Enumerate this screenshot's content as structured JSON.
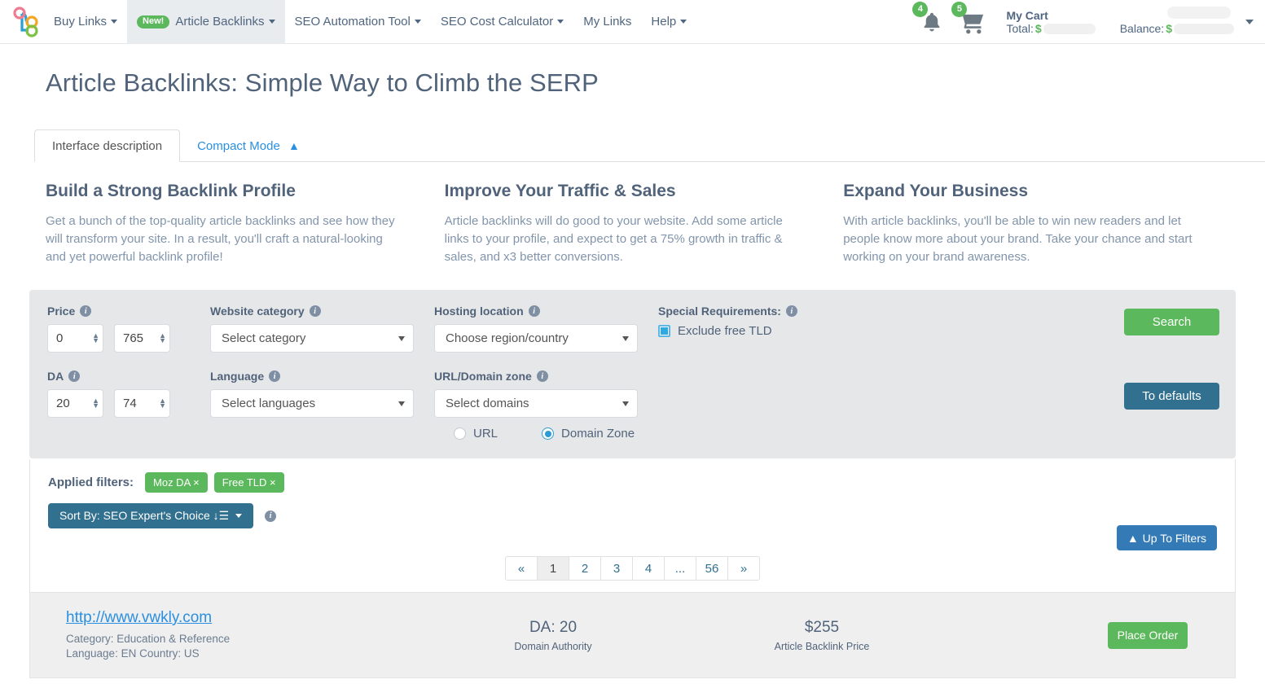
{
  "navbar": {
    "logo_icon": "node-tree-logo",
    "items": [
      {
        "label": "Buy Links",
        "has_caret": true,
        "badge": "",
        "active": false
      },
      {
        "label": "Article Backlinks",
        "has_caret": true,
        "badge": "New!",
        "active": true
      },
      {
        "label": "SEO Automation Tool",
        "has_caret": true,
        "badge": "",
        "active": false
      },
      {
        "label": "SEO Cost Calculator",
        "has_caret": true,
        "badge": "",
        "active": false
      },
      {
        "label": "My Links",
        "has_caret": false,
        "badge": "",
        "active": false
      },
      {
        "label": "Help",
        "has_caret": true,
        "badge": "",
        "active": false
      }
    ],
    "notifications_count": "4",
    "cart_count": "5",
    "cart_title": "My Cart",
    "cart_total_label": "Total:",
    "cart_currency": "$",
    "balance_label": "Balance:",
    "balance_currency": "$",
    "accent_green": "#5cb85c"
  },
  "page": {
    "title": "Article Backlinks: Simple Way to Climb the SERP"
  },
  "tabs": [
    {
      "label": "Interface description",
      "active": true
    },
    {
      "label": "Compact Mode",
      "active": false,
      "icon": "chevron-double-up-icon"
    }
  ],
  "features": [
    {
      "heading": "Build a Strong Backlink Profile",
      "text": "Get a bunch of the top-quality article backlinks and see how they will transform your site. In a result, you'll craft a natural-looking and yet powerful backlink profile!"
    },
    {
      "heading": "Improve Your Traffic & Sales",
      "text": "Article backlinks will do good to your website. Add some article links to your profile, and expect to get a 75% growth in traffic & sales, and x3 better conversions."
    },
    {
      "heading": "Expand Your Business",
      "text": "With article backlinks, you'll be able to win new readers and let people know more about your brand. Take your chance and start working on your brand awareness."
    }
  ],
  "filters": {
    "price": {
      "label": "Price",
      "min": "0",
      "max": "765"
    },
    "da": {
      "label": "DA",
      "min": "20",
      "max": "74"
    },
    "category": {
      "label": "Website category",
      "value": "Select category"
    },
    "language": {
      "label": "Language",
      "value": "Select languages"
    },
    "hosting": {
      "label": "Hosting location",
      "value": "Choose region/country"
    },
    "domain_zone": {
      "label": "URL/Domain zone",
      "value": "Select domains"
    },
    "special": {
      "label": "Special Requirements:",
      "checkbox_label": "Exclude free TLD",
      "checked": true
    },
    "radios": [
      {
        "label": "URL",
        "selected": false
      },
      {
        "label": "Domain Zone",
        "selected": true
      }
    ],
    "search_button": "Search",
    "defaults_button": "To defaults"
  },
  "applied": {
    "label": "Applied filters:",
    "tags": [
      "Moz DA ×",
      "Free TLD ×"
    ],
    "sort_button": "Sort By: SEO Expert's Choice ↓☰",
    "up_to_filters_button": "Up To Filters",
    "up_icon": "chevron-double-up-icon"
  },
  "pagination": {
    "items": [
      "«",
      "1",
      "2",
      "3",
      "4",
      "...",
      "56",
      "»"
    ],
    "active_index": 1
  },
  "results": [
    {
      "url": "http://www.vwkly.com",
      "category_line": "Category: Education & Reference",
      "language_line": "Language: EN Country: US",
      "da_value": "DA: 20",
      "da_label": "Domain Authority",
      "price_value": "$255",
      "price_label": "Article Backlink Price",
      "order_button": "Place Order"
    }
  ]
}
